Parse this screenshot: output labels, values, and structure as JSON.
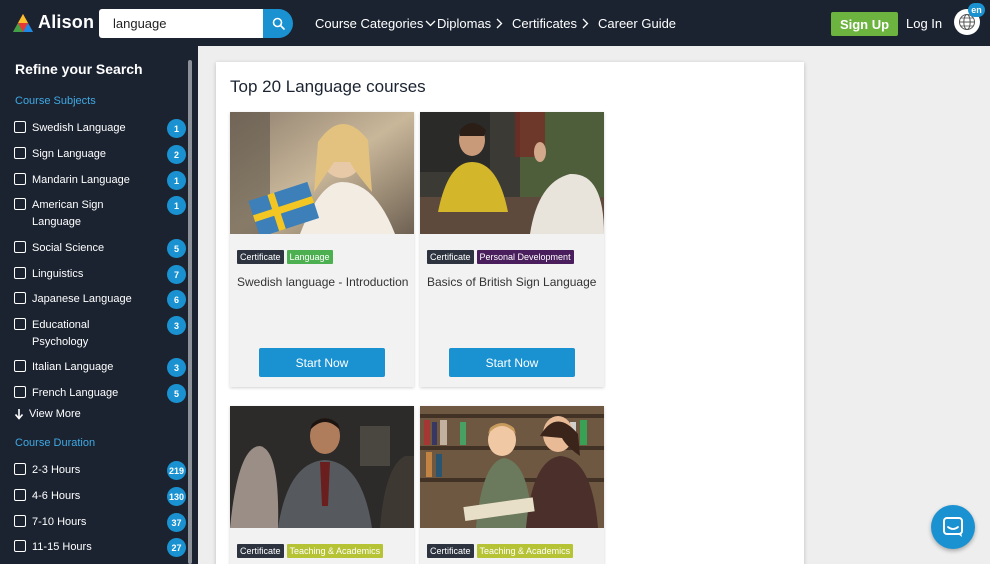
{
  "brand": {
    "name": "Alison"
  },
  "search": {
    "value": "language"
  },
  "nav": {
    "items": [
      {
        "label": "Course Categories",
        "chevron": "chevron-down"
      },
      {
        "label": "Diplomas",
        "chevron": "chevron-right"
      },
      {
        "label": "Certificates",
        "chevron": "chevron-right"
      },
      {
        "label": "Career Guide"
      }
    ],
    "signup_label": "Sign Up",
    "login_label": "Log In",
    "language_code": "en"
  },
  "sidebar": {
    "title": "Refine your Search",
    "subjects_heading": "Course Subjects",
    "subjects": [
      {
        "label": "Swedish Language",
        "count": "1"
      },
      {
        "label": "Sign Language",
        "count": "2"
      },
      {
        "label": "Mandarin Language",
        "count": "1"
      },
      {
        "label": "American Sign Language",
        "count": "1"
      },
      {
        "label": "Social Science",
        "count": "5"
      },
      {
        "label": "Linguistics",
        "count": "7"
      },
      {
        "label": "Japanese Language",
        "count": "6"
      },
      {
        "label": "Educational Psychology",
        "count": "3"
      },
      {
        "label": "Italian Language",
        "count": "3"
      },
      {
        "label": "French Language",
        "count": "5"
      }
    ],
    "view_more_label": "View More",
    "duration_heading": "Course Duration",
    "durations": [
      {
        "label": "2-3 Hours",
        "count": "219"
      },
      {
        "label": "4-6 Hours",
        "count": "130"
      },
      {
        "label": "7-10 Hours",
        "count": "37"
      },
      {
        "label": "11-15 Hours",
        "count": "27"
      }
    ]
  },
  "main": {
    "title": "Top 20 Language courses",
    "courses": [
      {
        "tags": [
          "Certificate",
          "Language"
        ],
        "tag_color": "#4caf50",
        "title": "Swedish language - Introduction",
        "button": "Start Now"
      },
      {
        "tags": [
          "Certificate",
          "Personal Development"
        ],
        "tag_color": "#4a1e5c",
        "title": "Basics of British Sign Language",
        "button": "Start Now"
      },
      {
        "tags": [
          "Certificate",
          "Teaching & Academics"
        ],
        "tag_color": "#b5c334",
        "title": "",
        "button": ""
      },
      {
        "tags": [
          "Certificate",
          "Teaching & Academics"
        ],
        "tag_color": "#b5c334",
        "title": "",
        "button": ""
      }
    ]
  },
  "colors": {
    "header_bg": "#1b2331",
    "accent": "#1a92d1",
    "signup": "#6cb33f"
  }
}
